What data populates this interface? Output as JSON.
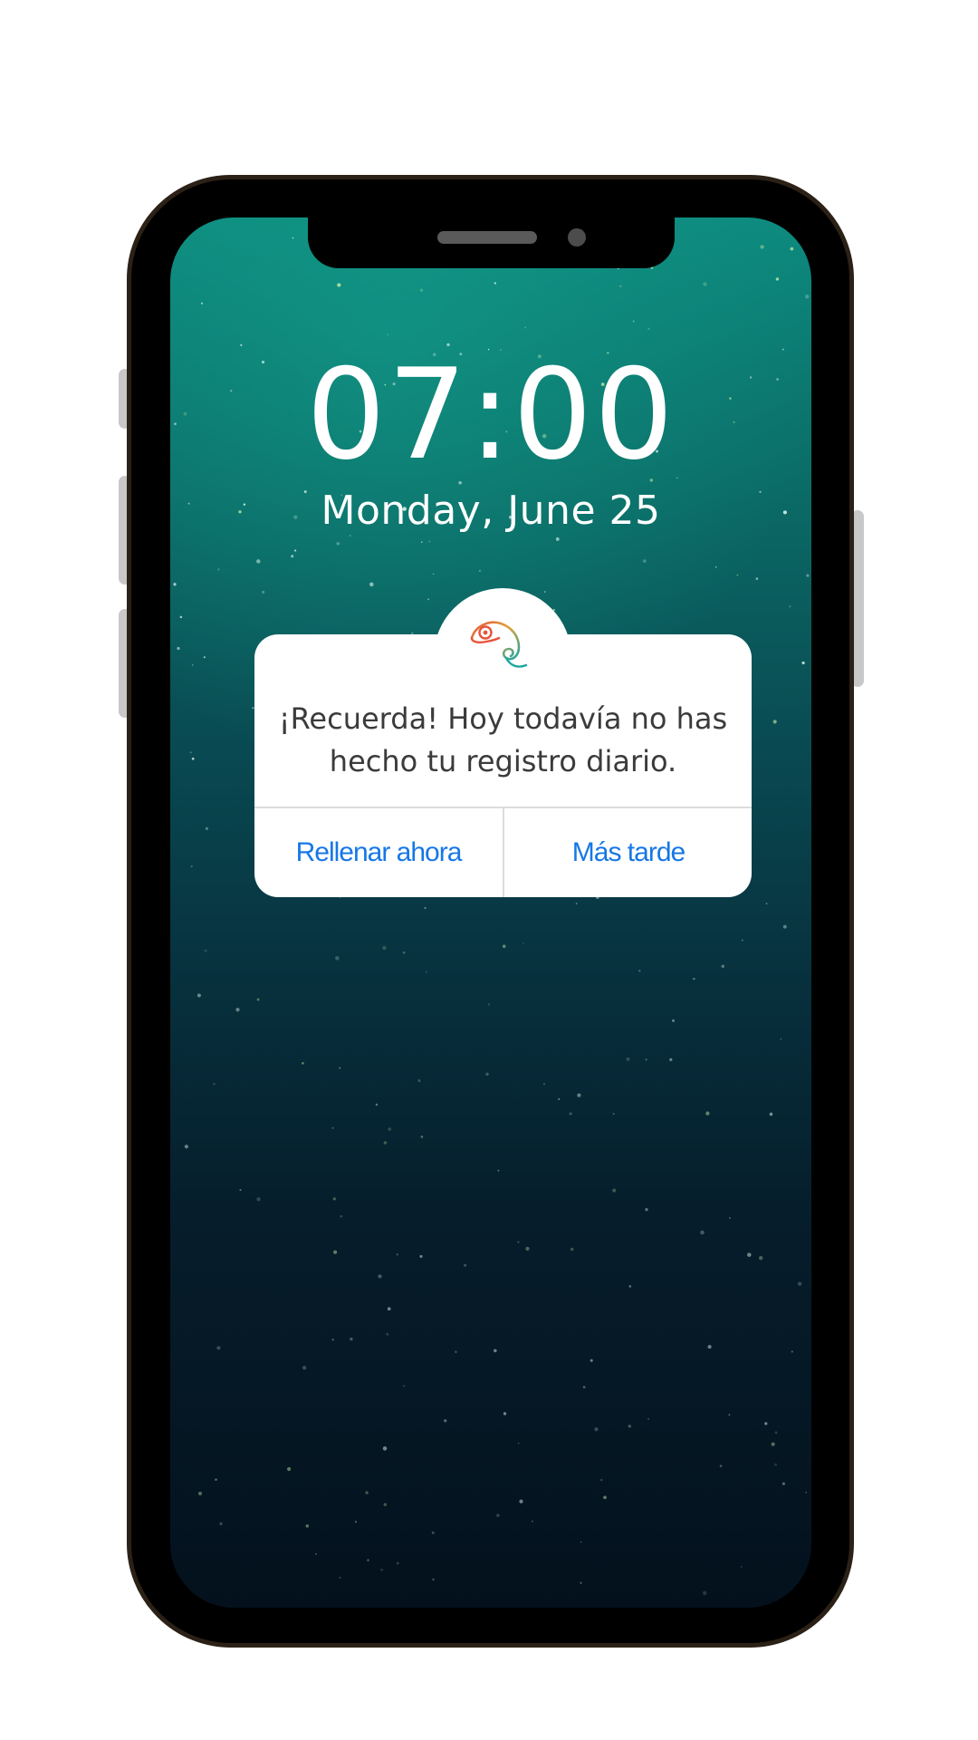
{
  "lock_screen": {
    "time": "07:00",
    "date": "Monday, June 25"
  },
  "notification": {
    "app_icon": "chameleon-icon",
    "message_line1": "¡Recuerda! Hoy todavía no has",
    "message_line2": "hecho tu registro diario.",
    "primary_action": "Rellenar ahora",
    "secondary_action": "Más tarde"
  },
  "colors": {
    "accent": "#1677e6",
    "wallpaper_top": "#0d8a7e",
    "wallpaper_bottom": "#04111d"
  }
}
